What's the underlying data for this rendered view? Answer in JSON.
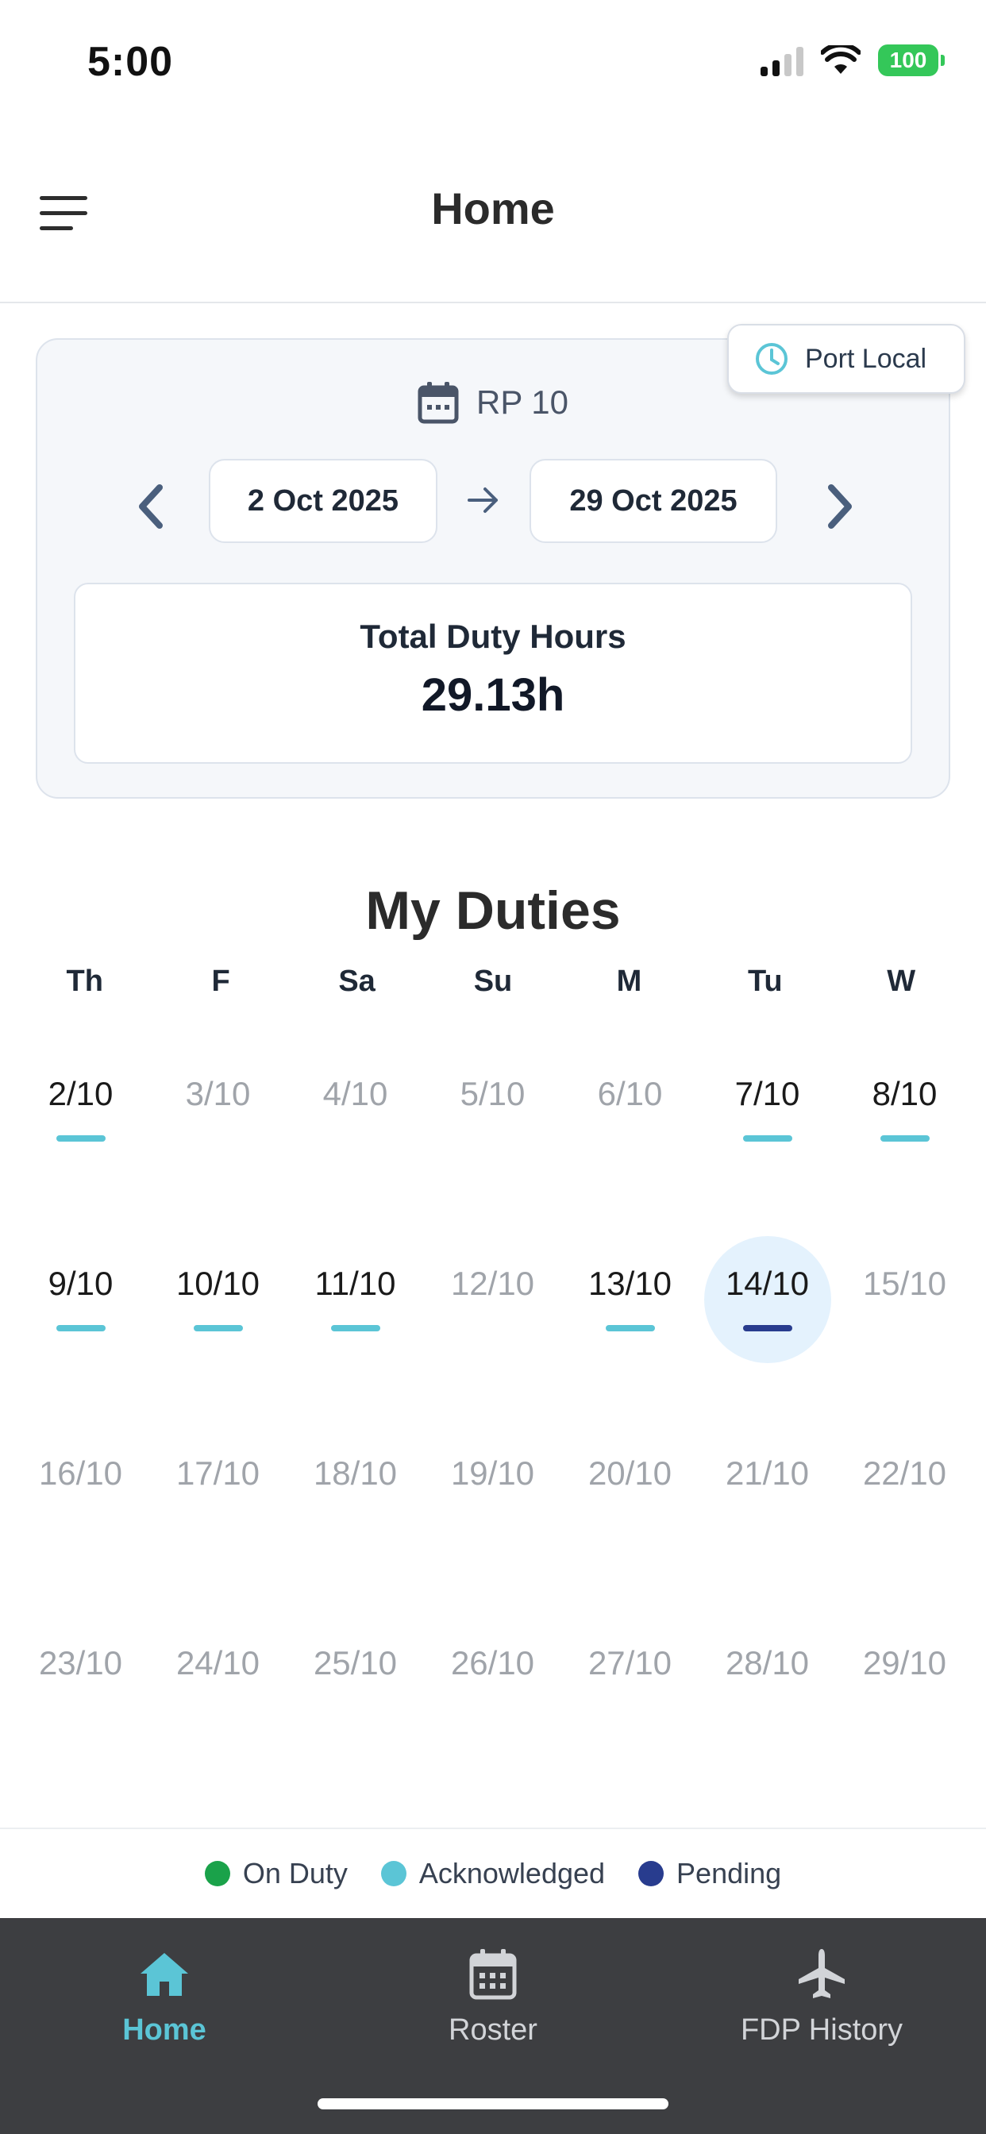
{
  "status_bar": {
    "time": "5:00",
    "battery": "100"
  },
  "header": {
    "title": "Home"
  },
  "period": {
    "port_chip": "Port Local",
    "rp_label": "RP 10",
    "start_date": "2 Oct 2025",
    "end_date": "29 Oct 2025",
    "total_label": "Total Duty Hours",
    "total_value": "29.13h"
  },
  "duties": {
    "title": "My Duties",
    "weekdays": [
      "Th",
      "F",
      "Sa",
      "Su",
      "M",
      "Tu",
      "W"
    ],
    "rows": [
      [
        {
          "label": "2/10",
          "active": true,
          "status": "acknowledged"
        },
        {
          "label": "3/10",
          "active": false,
          "status": ""
        },
        {
          "label": "4/10",
          "active": false,
          "status": ""
        },
        {
          "label": "5/10",
          "active": false,
          "status": ""
        },
        {
          "label": "6/10",
          "active": false,
          "status": ""
        },
        {
          "label": "7/10",
          "active": true,
          "status": "acknowledged"
        },
        {
          "label": "8/10",
          "active": true,
          "status": "acknowledged"
        }
      ],
      [
        {
          "label": "9/10",
          "active": true,
          "status": "acknowledged"
        },
        {
          "label": "10/10",
          "active": true,
          "status": "acknowledged"
        },
        {
          "label": "11/10",
          "active": true,
          "status": "acknowledged"
        },
        {
          "label": "12/10",
          "active": false,
          "status": ""
        },
        {
          "label": "13/10",
          "active": true,
          "status": "acknowledged"
        },
        {
          "label": "14/10",
          "active": true,
          "status": "pending",
          "selected": true
        },
        {
          "label": "15/10",
          "active": false,
          "status": ""
        }
      ],
      [
        {
          "label": "16/10",
          "active": false,
          "status": ""
        },
        {
          "label": "17/10",
          "active": false,
          "status": ""
        },
        {
          "label": "18/10",
          "active": false,
          "status": ""
        },
        {
          "label": "19/10",
          "active": false,
          "status": ""
        },
        {
          "label": "20/10",
          "active": false,
          "status": ""
        },
        {
          "label": "21/10",
          "active": false,
          "status": ""
        },
        {
          "label": "22/10",
          "active": false,
          "status": ""
        }
      ],
      [
        {
          "label": "23/10",
          "active": false,
          "status": ""
        },
        {
          "label": "24/10",
          "active": false,
          "status": ""
        },
        {
          "label": "25/10",
          "active": false,
          "status": ""
        },
        {
          "label": "26/10",
          "active": false,
          "status": ""
        },
        {
          "label": "27/10",
          "active": false,
          "status": ""
        },
        {
          "label": "28/10",
          "active": false,
          "status": ""
        },
        {
          "label": "29/10",
          "active": false,
          "status": ""
        }
      ]
    ]
  },
  "legend": [
    {
      "label": "On Duty",
      "color": "#1aa24a"
    },
    {
      "label": "Acknowledged",
      "color": "#5bc5d6"
    },
    {
      "label": "Pending",
      "color": "#283c8e"
    }
  ],
  "status_colors": {
    "acknowledged": "#5bc5d6",
    "pending": "#283c8e",
    "on_duty": "#1aa24a"
  },
  "tabs": [
    {
      "label": "Home",
      "icon": "home-icon",
      "active": true
    },
    {
      "label": "Roster",
      "icon": "calendar-icon",
      "active": false
    },
    {
      "label": "FDP History",
      "icon": "airplane-icon",
      "active": false
    }
  ]
}
